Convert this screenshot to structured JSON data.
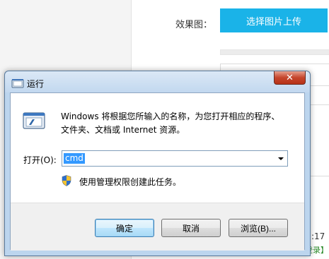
{
  "background": {
    "effect_label": "效果图：",
    "upload_button": "选择图片上传",
    "time_fragment": ":17",
    "login_fragment": "登录】"
  },
  "dialog": {
    "title": "运行",
    "close_symbol": "✕",
    "description": "Windows 将根据您所输入的名称，为您打开相应的程序、\n文件夹、文档或 Internet 资源。",
    "open_label": "打开(O):",
    "open_value": "cmd",
    "admin_note": "使用管理权限创建此任务。",
    "buttons": {
      "ok": "确定",
      "cancel": "取消",
      "browse": "浏览(B)..."
    }
  },
  "colors": {
    "upload_button_bg": "#1ab3e8",
    "selection_highlight": "#3399ff",
    "close_button": "#c5452c"
  }
}
